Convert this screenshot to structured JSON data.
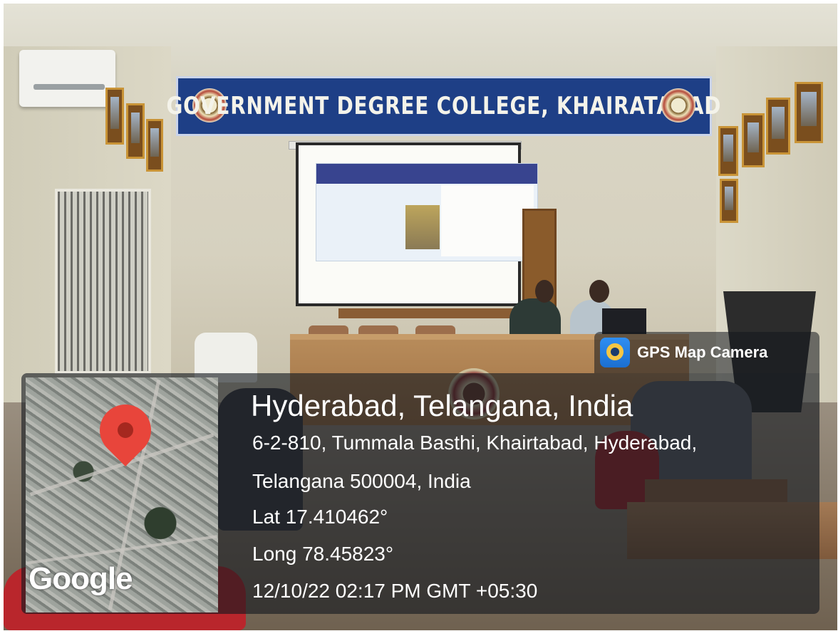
{
  "banner": {
    "title": "GOVERNMENT DEGREE COLLEGE, KHAIRATABAD"
  },
  "overlay": {
    "app_name": "GPS Map Camera",
    "app_icon": "gps-map-camera-icon",
    "location_title": "Hyderabad, Telangana, India",
    "address_line_1": "6-2-810, Tummala Basthi, Khairtabad, Hyderabad,",
    "address_line_2": "Telangana 500004, India",
    "latitude": "Lat 17.410462°",
    "longitude": "Long 78.45823°",
    "timestamp": "12/10/22 02:17 PM GMT +05:30",
    "map_watermark": "Google",
    "pin_color": "#e8453b"
  }
}
